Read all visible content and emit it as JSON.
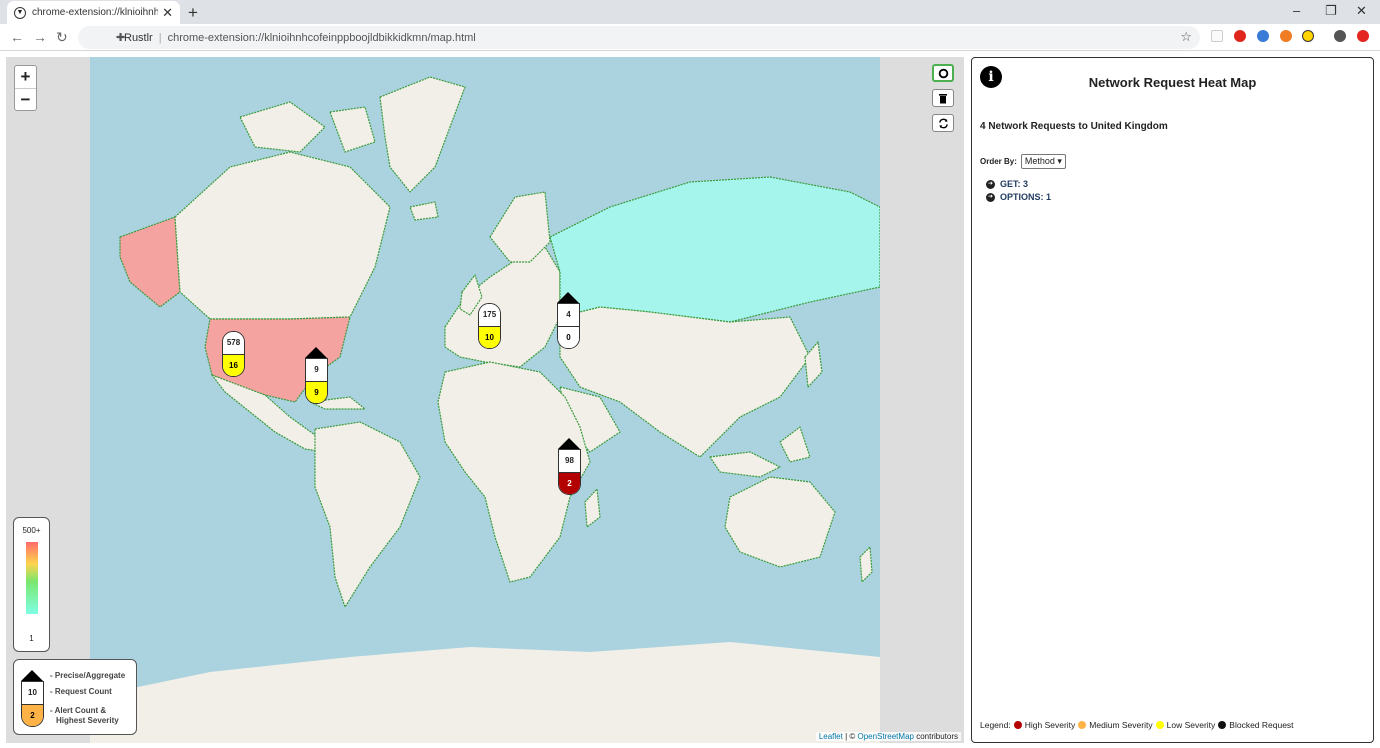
{
  "browser": {
    "tab_title": "chrome-extension://klnioihnhcofeinppboojldbikkidkmn",
    "tab_close": "✕",
    "new_tab": "+",
    "site_name": "Rustlr",
    "url": "chrome-extension://klnioihnhcofeinppboojldbikkidkmn/map.html",
    "window_controls": [
      "–",
      "❐",
      "✕"
    ]
  },
  "map": {
    "zoom_in": "+",
    "zoom_out": "−",
    "controls": [
      "target-icon",
      "trash-icon",
      "refresh-icon"
    ],
    "attribution_leaflet": "Leaflet",
    "attribution_sep": " | © ",
    "attribution_osm": "OpenStreetMap",
    "attribution_tail": " contributors",
    "scale_max": "500+",
    "scale_min": "1",
    "markers": [
      {
        "id": "usa-west",
        "count": "578",
        "alert": "16",
        "precise": false,
        "alert_color": "#ffff00",
        "alert_text": "#000"
      },
      {
        "id": "usa-east",
        "count": "9",
        "alert": "9",
        "precise": true,
        "alert_color": "#ffff00",
        "alert_text": "#000"
      },
      {
        "id": "europe-west",
        "count": "175",
        "alert": "10",
        "precise": false,
        "alert_color": "#ffff00",
        "alert_text": "#000"
      },
      {
        "id": "europe-east",
        "count": "4",
        "alert": "0",
        "precise": true,
        "alert_color": "#ffffff",
        "alert_text": "#000"
      },
      {
        "id": "africa",
        "count": "98",
        "alert": "2",
        "precise": true,
        "alert_color": "#b30000",
        "alert_text": "#fff"
      }
    ],
    "key": {
      "sample_count": "10",
      "sample_alert": "2",
      "precise_label": "- Precise/Aggregate",
      "count_label": "- Request Count",
      "alert_label_1": "- Alert Count &",
      "alert_label_2": "Highest Severity"
    }
  },
  "panel": {
    "title": "Network Request Heat Map",
    "subtitle": "4 Network Requests to United Kingdom",
    "order_label": "Order By:",
    "order_value": "Method ▾",
    "groups": [
      "GET: 3",
      "OPTIONS: 1"
    ],
    "legend_label": "Legend:",
    "legend": [
      {
        "label": "High Severity",
        "color": "#b30000"
      },
      {
        "label": "Medium Severity",
        "color": "#ffb347"
      },
      {
        "label": "Low Severity",
        "color": "#ffff00"
      },
      {
        "label": "Blocked Request",
        "color": "#111111"
      }
    ]
  },
  "colors": {
    "ocean": "#aad3df",
    "land": "#f2efe9",
    "border": "#3a9a3a",
    "heat_high": "#f4a3a0",
    "heat_low": "#a6f5ec"
  }
}
